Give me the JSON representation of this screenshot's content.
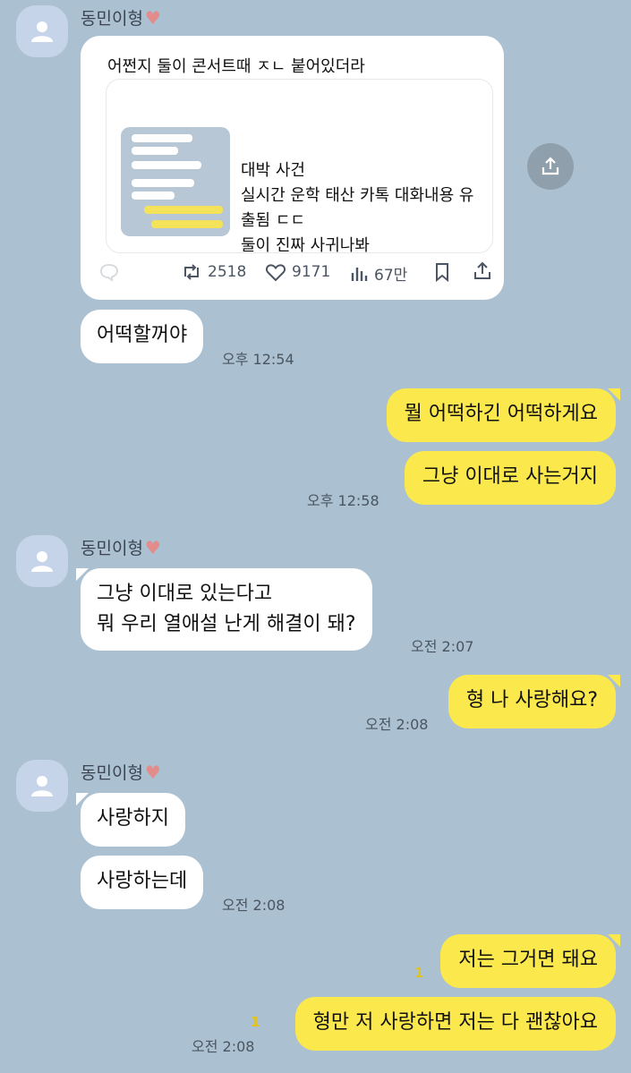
{
  "contact": {
    "name": "동민이형",
    "heart": "♥"
  },
  "groups": [
    {
      "card": {
        "text": "어쩐지 둘이 콘서트때 ㅈㄴ 붙어있더라",
        "link_lines": [
          "대박 사건",
          "실시간 운학 태산 카톡 대화내용 유",
          "출됨 ㄷㄷ",
          "둘이 진짜 사귀나봐"
        ],
        "retweets": "2518",
        "likes": "9171",
        "views": "67만"
      },
      "messages": [
        {
          "text": "어떡할꺼야",
          "time": "오후 12:54"
        }
      ]
    },
    {
      "messages": [
        {
          "lines": [
            "그냥 이대로 있는다고",
            "뭐 우리 열애설 난게 해결이 돼?"
          ],
          "time": "오전 2:07"
        }
      ]
    },
    {
      "messages": [
        {
          "text": "사랑하지"
        },
        {
          "text": "사랑하는데",
          "time": "오전 2:08"
        }
      ]
    }
  ],
  "sent": [
    {
      "text": "뭘 어떡하긴 어떡하게요"
    },
    {
      "text": "그냥 이대로 사는거지",
      "time": "오후 12:58"
    },
    {
      "text": "형 나 사랑해요?",
      "time": "오전 2:08"
    },
    {
      "text": "저는 그거면 돼요",
      "unread": "1"
    },
    {
      "text": "형만 저 사랑하면 저는 다 괜찮아요",
      "unread": "1",
      "time": "오전 2:08"
    }
  ],
  "colors": {
    "background": "#abc1d1",
    "sent_bubble": "#fae84c",
    "received_bubble": "#ffffff",
    "avatar": "#c6d4ea",
    "unread": "#e2c21a"
  },
  "icons": [
    "person-icon",
    "heart-icon",
    "comment-icon",
    "retweet-icon",
    "like-icon",
    "views-icon",
    "bookmark-icon",
    "share-icon"
  ]
}
